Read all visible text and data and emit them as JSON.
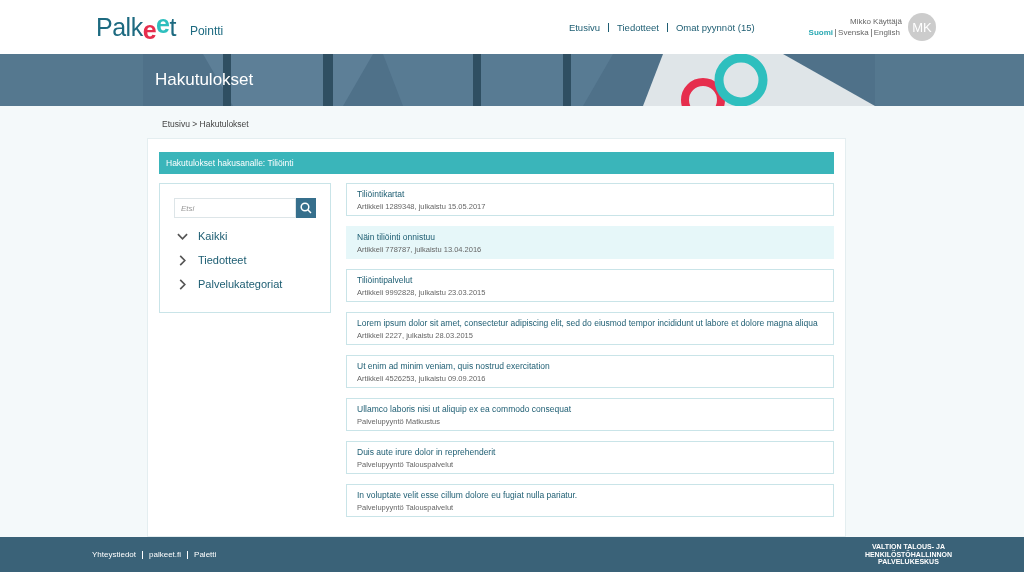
{
  "header": {
    "logo": [
      "Palk",
      "e",
      "e",
      "t"
    ],
    "app_name": "Pointti",
    "nav": [
      "Etusivu",
      "Tiedotteet",
      "Omat pyynnöt (15)"
    ],
    "user_name": "Mikko Käyttäjä",
    "avatar": "MK",
    "languages": [
      {
        "label": "Suomi",
        "selected": true
      },
      {
        "label": "Svenska",
        "selected": false
      },
      {
        "label": "English",
        "selected": false
      }
    ]
  },
  "banner": {
    "title": "Hakutulokset"
  },
  "breadcrumb": "Etusivu > Hakutulokset",
  "results_heading": "Hakutulokset hakusanalle: Tiliöinti",
  "filter": {
    "search": {
      "placeholder": "Etsi"
    },
    "items": [
      {
        "label": "Kaikki",
        "expanded": true
      },
      {
        "label": "Tiedotteet",
        "expanded": false
      },
      {
        "label": "Palvelukategoriat",
        "expanded": false
      }
    ]
  },
  "results": [
    {
      "title": "Tiliöintikartat",
      "meta": "Artikkeli 1289348, julkaistu 15.05.2017",
      "selected": false
    },
    {
      "title": "Näin tiliöinti onnistuu",
      "meta": "Artikkeli 778787, julkaistu 13.04.2016",
      "selected": true
    },
    {
      "title": "Tiliöintipalvelut",
      "meta": "Artikkeli 9992828, julkaistu 23.03.2015",
      "selected": false
    },
    {
      "title": "Lorem ipsum dolor sit amet, consectetur adipiscing elit, sed do eiusmod tempor incididunt ut labore et dolore magna aliqua",
      "meta": "Artikkeli 2227, julkaistu 28.03.2015",
      "selected": false
    },
    {
      "title": "Ut enim ad minim veniam, quis nostrud exercitation",
      "meta": "Artikkeli 4526253, julkaistu 09.09.2016",
      "selected": false
    },
    {
      "title": "Ullamco laboris nisi ut aliquip ex ea commodo consequat",
      "meta": "Palvelupyyntö Matkustus",
      "selected": false
    },
    {
      "title": "Duis aute irure dolor in reprehenderit",
      "meta": "Palvelupyyntö Talouspalvelut",
      "selected": false
    },
    {
      "title": "In voluptate velit esse cillum dolore eu fugiat nulla pariatur.",
      "meta": "Palvelupyyntö Talouspalvelut",
      "selected": false
    }
  ],
  "footer": {
    "links": [
      "Yhteystiedot",
      "palkeet.fi",
      "Paletti"
    ],
    "org_logo": "VALTION TALOUS- JA\nHENKILÖSTÖHALLINNON\nPALVELUKESKUS"
  }
}
